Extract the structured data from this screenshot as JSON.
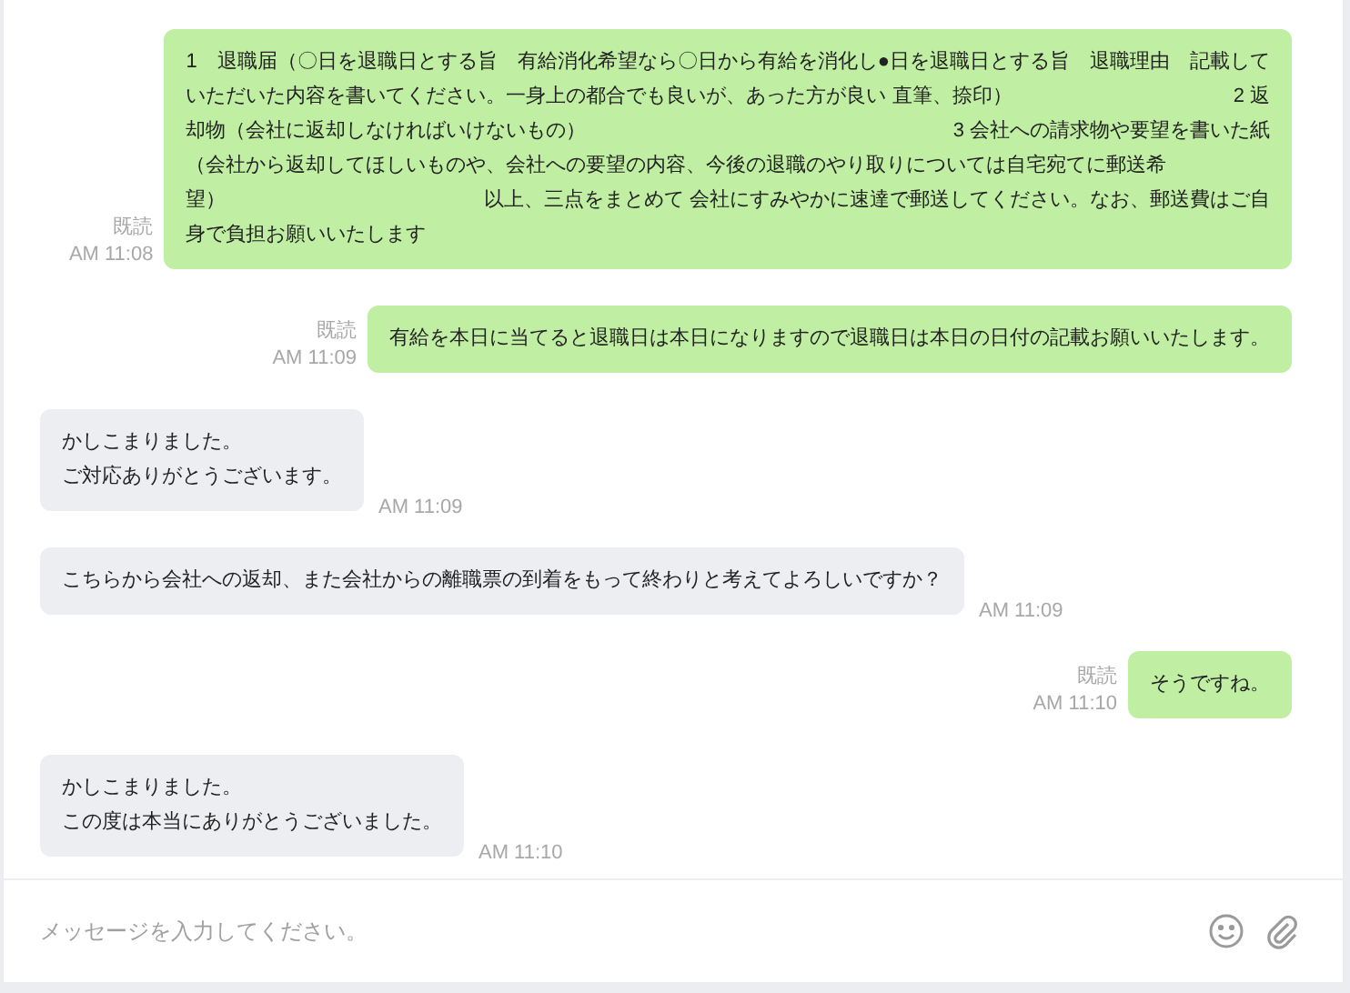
{
  "messages": [
    {
      "kind": "sent",
      "read": "既読",
      "time": "AM 11:08",
      "lines": [
        {
          "text": "1　退職届（〇日を退職日とする旨　有給消化希望なら〇日から有給を消化し●日を退職日とする旨　退職理由　記載して"
        },
        {
          "text": "いただいた内容を書いてください。一身上の都合でも良いが、あった方が良い 直筆、捺印）",
          "end": "2 返"
        },
        {
          "text": "却物（会社に返却しなければいけないもの）",
          "end": "3 会社への請求物や要望を書いた紙"
        },
        {
          "text": "（会社から返却してほしいものや、会社への要望の内容、今後の退職のやり取りについては自宅宛てに郵送希"
        },
        {
          "text": "望）",
          "end": "以上、三点をまとめて 会社にすみやかに速達で郵送してください。なお、郵送費はご自"
        },
        {
          "text": "身で負担お願いいたします"
        }
      ]
    },
    {
      "kind": "sent",
      "read": "既読",
      "time": "AM 11:09",
      "lines": [
        {
          "text": "有給を本日に当てると退職日は本日になりますので退職日は本日の日付の記載お願いいたします。"
        }
      ]
    },
    {
      "kind": "received",
      "time": "AM 11:09",
      "lines": [
        {
          "text": "かしこまりました。"
        },
        {
          "text": "ご対応ありがとうございます。"
        }
      ]
    },
    {
      "kind": "received",
      "time": "AM 11:09",
      "lines": [
        {
          "text": "こちらから会社への返却、また会社からの離職票の到着をもって終わりと考えてよろしいですか？"
        }
      ]
    },
    {
      "kind": "sent",
      "read": "既読",
      "time": "AM 11:10",
      "lines": [
        {
          "text": "そうですね。"
        }
      ]
    },
    {
      "kind": "received",
      "time": "AM 11:10",
      "lines": [
        {
          "text": "かしこまりました。"
        },
        {
          "text": "この度は本当にありがとうございました。"
        }
      ]
    }
  ],
  "composer": {
    "placeholder": "メッセージを入力してください。"
  }
}
